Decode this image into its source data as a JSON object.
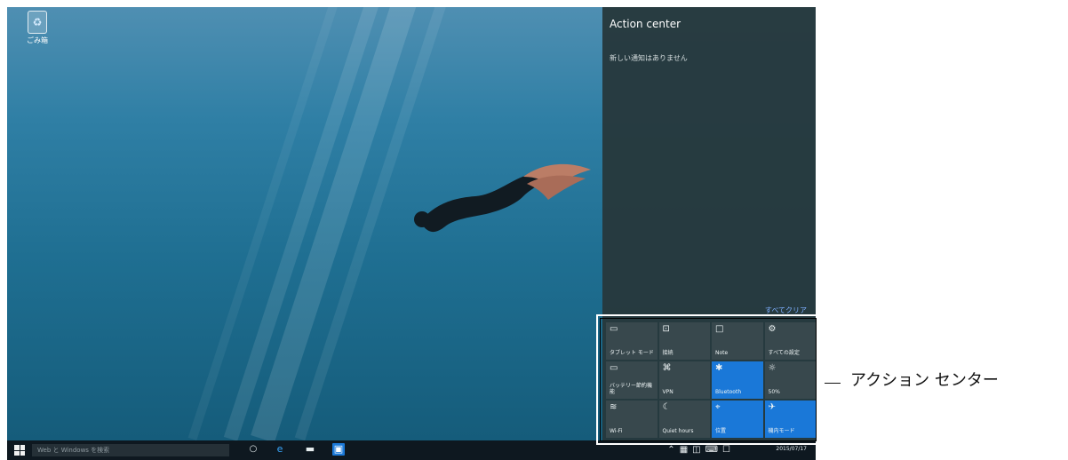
{
  "desktop": {
    "recycle_bin": {
      "label": "ごみ箱",
      "icon": "recycle-bin-icon"
    }
  },
  "action_center": {
    "title": "Action center",
    "empty_message": "新しい通知はありません",
    "clear_all": "すべてクリア",
    "quick_actions": [
      {
        "label": "タブレット モード",
        "icon": "tablet-mode-icon",
        "active": false
      },
      {
        "label": "接続",
        "icon": "connect-icon",
        "active": false
      },
      {
        "label": "Note",
        "icon": "note-icon",
        "active": false
      },
      {
        "label": "すべての設定",
        "icon": "settings-icon",
        "active": false
      },
      {
        "label": "バッテリー節約機能",
        "icon": "battery-saver-icon",
        "active": false
      },
      {
        "label": "VPN",
        "icon": "vpn-icon",
        "active": false
      },
      {
        "label": "Bluetooth",
        "icon": "bluetooth-icon",
        "active": true
      },
      {
        "label": "50%",
        "icon": "brightness-icon",
        "active": false
      },
      {
        "label": "Wi-Fi",
        "icon": "wifi-icon",
        "active": false
      },
      {
        "label": "Quiet hours",
        "icon": "quiet-hours-icon",
        "active": false
      },
      {
        "label": "位置",
        "icon": "location-icon",
        "active": true
      },
      {
        "label": "機内モード",
        "icon": "airplane-mode-icon",
        "active": true
      }
    ]
  },
  "taskbar": {
    "search_placeholder": "Web と Windows を検索",
    "date": "2015/07/17"
  },
  "annotation": {
    "label": "アクション センター"
  },
  "colors": {
    "tile_active": "#1a78d8",
    "tile_inactive": "#38484d",
    "panel": "#26383c"
  }
}
